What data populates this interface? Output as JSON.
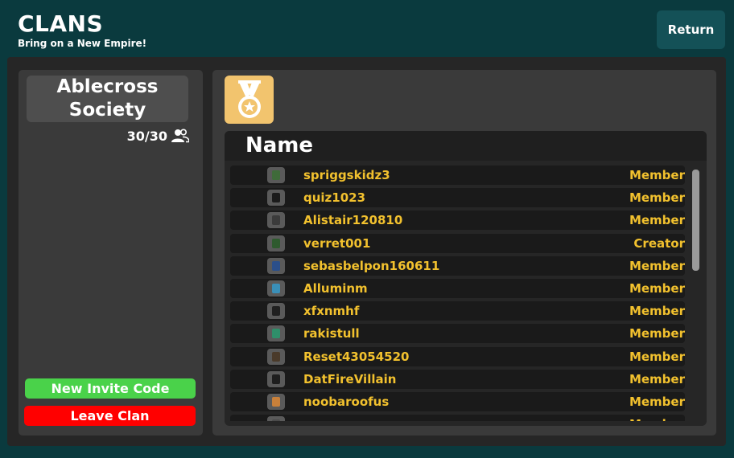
{
  "header": {
    "title": "CLANS",
    "subtitle": "Bring on a New Empire!",
    "return_label": "Return"
  },
  "clan": {
    "name": "Ablecross Society",
    "member_count": "30/30",
    "count_icon": "people-icon",
    "invite_label": "New Invite Code",
    "leave_label": "Leave Clan"
  },
  "badge": {
    "icon": "medal-icon",
    "color": "#f2c46e"
  },
  "members_list": {
    "column_header": "Name",
    "rows": [
      {
        "username": "spriggskidz3",
        "role": "Member",
        "avatar_color": "#3f6b3a"
      },
      {
        "username": "quiz1023",
        "role": "Member",
        "avatar_color": "#1b1b1b"
      },
      {
        "username": "Alistair120810",
        "role": "Member",
        "avatar_color": "#3b3b3b"
      },
      {
        "username": "verret001",
        "role": "Creator",
        "avatar_color": "#2e5a2e"
      },
      {
        "username": "sebasbelpon160611",
        "role": "Member",
        "avatar_color": "#2b4f8a"
      },
      {
        "username": "Alluminm",
        "role": "Member",
        "avatar_color": "#3a8fb8"
      },
      {
        "username": "xfxnmhf",
        "role": "Member",
        "avatar_color": "#202020"
      },
      {
        "username": "rakistull",
        "role": "Member",
        "avatar_color": "#2f8f6a"
      },
      {
        "username": "Reset43054520",
        "role": "Member",
        "avatar_color": "#4a3a2a"
      },
      {
        "username": "DatFireVillain",
        "role": "Member",
        "avatar_color": "#1e1e1e"
      },
      {
        "username": "noobaroofus",
        "role": "Member",
        "avatar_color": "#c8803a"
      },
      {
        "username": "",
        "role": "Member",
        "avatar_color": "#4a4a4a"
      }
    ]
  },
  "colors": {
    "background": "#0a3a3e",
    "panel": "#262626",
    "accent_text": "#f2c12e",
    "invite_button": "#4ad24a",
    "leave_button": "#ff0000",
    "return_button": "#145157"
  }
}
